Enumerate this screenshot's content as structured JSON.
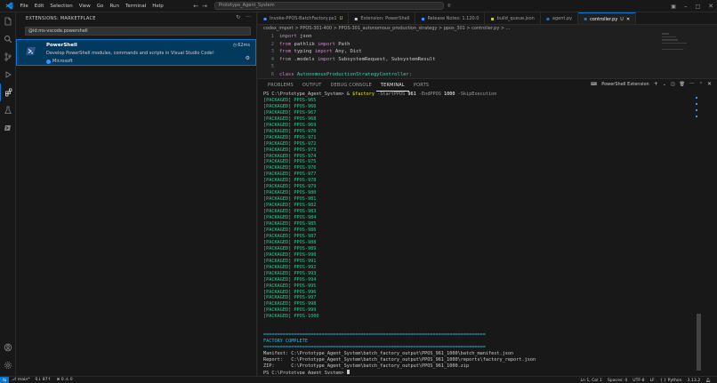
{
  "window": {
    "menu": [
      "File",
      "Edit",
      "Selection",
      "View",
      "Go",
      "Run",
      "Terminal",
      "Help"
    ],
    "search_text": "Prototype_Agent_System"
  },
  "sidebar": {
    "header": "EXTENSIONS: MARKETPLACE",
    "search_value": "@id:ms-vscode.powershell",
    "extension": {
      "name": "PowerShell",
      "description": "Develop PowerShell modules, commands and scripts in Visual Studio Code!",
      "publisher": "Microsoft",
      "install_time": "62ms"
    }
  },
  "editor": {
    "tabs": [
      {
        "label": "Invoke-PPOS-BatchFactory.ps1",
        "mod": "U",
        "active": false,
        "color": "#5391fe"
      },
      {
        "label": "Extension: PowerShell",
        "mod": "",
        "active": false,
        "color": "#cccccc"
      },
      {
        "label": "Release Notes: 1.120.0",
        "mod": "",
        "active": false,
        "color": "#3794ff"
      },
      {
        "label": "build_queue.json",
        "mod": "",
        "active": false,
        "color": "#cbcb41"
      },
      {
        "label": "agent.py",
        "mod": "",
        "active": false,
        "color": "#3572a5"
      },
      {
        "label": "controller.py",
        "mod": "U",
        "active": true,
        "color": "#3572a5"
      }
    ],
    "breadcrumbs": "codex_import > PPOS-301-400 > PPOS-301_autonomous_production_strategy > ppos_301 > controller.py > ...",
    "lines": [
      {
        "num": "1",
        "segments": [
          {
            "t": "import",
            "c": "kw"
          },
          {
            "t": " json",
            "c": "plain"
          }
        ]
      },
      {
        "num": "2",
        "segments": [
          {
            "t": "from",
            "c": "kw"
          },
          {
            "t": " pathlib ",
            "c": "plain"
          },
          {
            "t": "import",
            "c": "kw"
          },
          {
            "t": " Path",
            "c": "plain"
          }
        ]
      },
      {
        "num": "3",
        "segments": [
          {
            "t": "from",
            "c": "kw"
          },
          {
            "t": " typing ",
            "c": "plain"
          },
          {
            "t": "import",
            "c": "kw"
          },
          {
            "t": " Any, Dict",
            "c": "plain"
          }
        ]
      },
      {
        "num": "4",
        "segments": [
          {
            "t": "from",
            "c": "kw"
          },
          {
            "t": " .models ",
            "c": "plain"
          },
          {
            "t": "import",
            "c": "kw"
          },
          {
            "t": " SubsystemRequest, SubsystemResult",
            "c": "plain"
          }
        ]
      },
      {
        "num": "5",
        "segments": []
      },
      {
        "num": "6",
        "segments": [
          {
            "t": "class",
            "c": "kw"
          },
          {
            "t": " AutonomousProductionStrategyController:",
            "c": "cls"
          }
        ]
      }
    ]
  },
  "panel": {
    "tabs": [
      "PROBLEMS",
      "OUTPUT",
      "DEBUG CONSOLE",
      "TERMINAL",
      "PORTS"
    ],
    "active_tab": "TERMINAL",
    "terminal_instance": "PowerShell Extension"
  },
  "terminal": {
    "prompt": "PS C:\\Prototype_Agent_System>",
    "command": {
      "name": "$factory",
      "args": [
        {
          "p": " -StartPPOS",
          "v": " 961"
        },
        {
          "p": " -EndPPOS",
          "v": " 1000"
        },
        {
          "p": " -SkipExecution",
          "v": ""
        }
      ]
    },
    "packaged_tag": "[PACKAGED]",
    "packaged_ids": [
      "PPOS-965",
      "PPOS-966",
      "PPOS-967",
      "PPOS-968",
      "PPOS-969",
      "PPOS-970",
      "PPOS-971",
      "PPOS-972",
      "PPOS-973",
      "PPOS-974",
      "PPOS-975",
      "PPOS-976",
      "PPOS-977",
      "PPOS-978",
      "PPOS-979",
      "PPOS-980",
      "PPOS-981",
      "PPOS-982",
      "PPOS-983",
      "PPOS-984",
      "PPOS-985",
      "PPOS-986",
      "PPOS-987",
      "PPOS-988",
      "PPOS-989",
      "PPOS-990",
      "PPOS-991",
      "PPOS-992",
      "PPOS-993",
      "PPOS-994",
      "PPOS-995",
      "PPOS-996",
      "PPOS-997",
      "PPOS-998",
      "PPOS-999",
      "PPOS-1000"
    ],
    "separator": "================================================================================",
    "complete_title": "FACTORY COMPLETE",
    "results": [
      {
        "label": "Manifest:",
        "value": "C:\\Prototype_Agent_System\\batch_factory_output\\PPOS_961_1000\\batch_manifest.json"
      },
      {
        "label": "Report:  ",
        "value": "C:\\Prototype_Agent_System\\batch_factory_output\\PPOS_961_1000\\reports\\factory_report.json"
      },
      {
        "label": "ZIP:     ",
        "value": "C:\\Prototype_Agent_System\\batch_factory_output\\PPOS_961_1000.zip"
      }
    ]
  },
  "statusbar": {
    "branch": "main*",
    "sync": "0↓ 87↑",
    "problems": "⊗ 0 ⚠ 0",
    "position": "Ln 1, Col 1",
    "spaces": "Spaces: 4",
    "encoding": "UTF-8",
    "eol": "LF",
    "language": "{ } Python",
    "version": "3.13.2"
  }
}
